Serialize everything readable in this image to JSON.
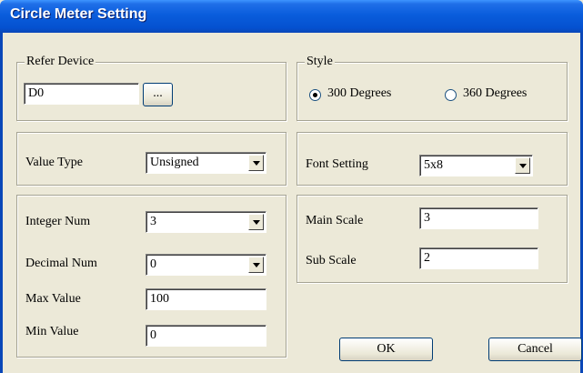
{
  "window": {
    "title": "Circle Meter Setting"
  },
  "refer_device": {
    "legend": "Refer Device",
    "value": "D0",
    "browse_label": "..."
  },
  "style": {
    "legend": "Style",
    "option_300": "300 Degrees",
    "option_360": "360 Degrees",
    "selected": "300 Degrees"
  },
  "value_type": {
    "label": "Value Type",
    "selected": "Unsigned"
  },
  "font_setting": {
    "label": "Font Setting",
    "selected": "5x8"
  },
  "numbers": {
    "integer_num_label": "Integer Num",
    "integer_num": "3",
    "decimal_num_label": "Decimal Num",
    "decimal_num": "0",
    "max_value_label": "Max Value",
    "max_value": "100",
    "min_value_label": "Min Value",
    "min_value": "0"
  },
  "scale": {
    "main_label": "Main Scale",
    "main_value": "3",
    "sub_label": "Sub Scale",
    "sub_value": "2"
  },
  "buttons": {
    "ok": "OK",
    "cancel": "Cancel"
  },
  "colors": {
    "title_bar": "#0a5ddc",
    "dialog_bg": "#ece9d8",
    "frame_border": "#a5a393"
  }
}
